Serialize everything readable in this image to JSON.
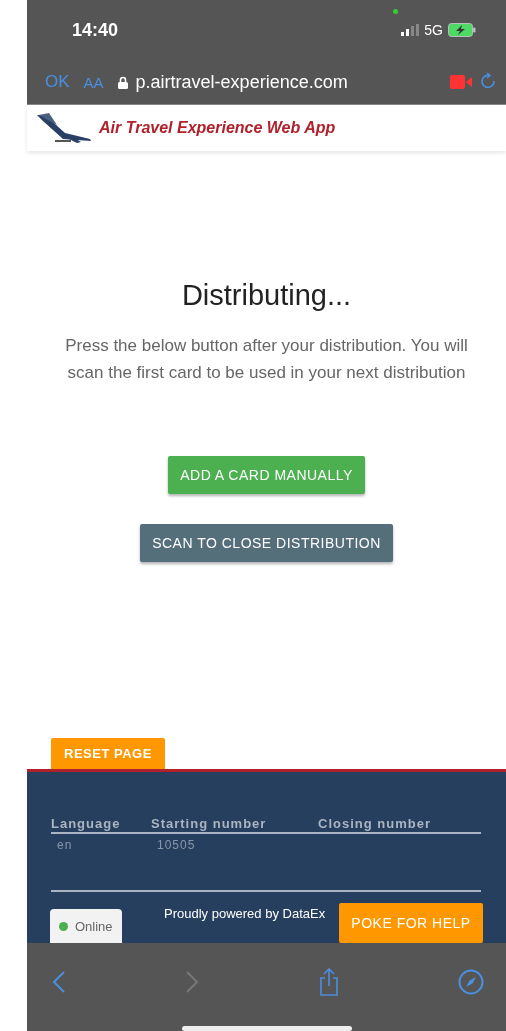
{
  "status_bar": {
    "time": "14:40",
    "network": "5G"
  },
  "browser": {
    "done": "OK",
    "text_size": "AA",
    "url": "p.airtravel-experience.com"
  },
  "app_header": {
    "title": "Air Travel Experience Web App"
  },
  "main": {
    "heading": "Distributing...",
    "message": "Press the below button after your distribution. You will scan the first card to be used in your next distribution",
    "buttons": [
      {
        "label": "ADD A CARD MANUALLY",
        "kind": "primary"
      },
      {
        "label": "SCAN TO CLOSE DISTRIBUTION",
        "kind": "secondary"
      }
    ],
    "reset_button": "RESET PAGE"
  },
  "footer": {
    "table": {
      "columns": [
        "Language",
        "Starting number",
        "Closing number"
      ],
      "rows": [
        [
          "en",
          "10505",
          ""
        ]
      ]
    },
    "powered_by": "Proudly powered by DataEx",
    "connection": {
      "label": "Online",
      "color": "#4caf50"
    },
    "help_button": "POKE FOR HELP"
  }
}
